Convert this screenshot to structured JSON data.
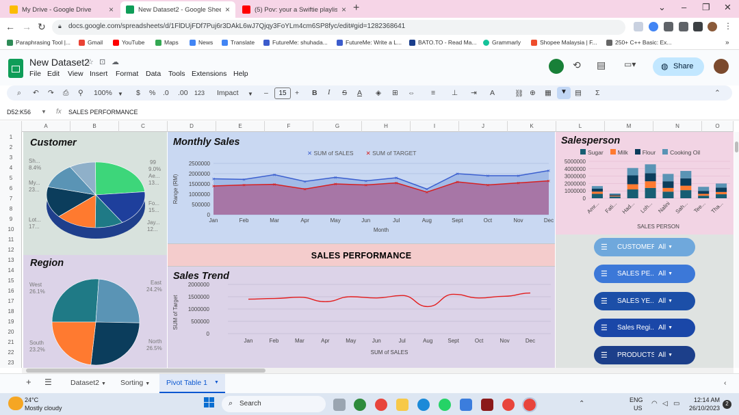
{
  "browser": {
    "tabs": [
      {
        "title": "My Drive - Google Drive",
        "color": "#fbbc04"
      },
      {
        "title": "New Dataset2 - Google Sheets",
        "color": "#0f9d58"
      },
      {
        "title": "(5) Pov: your a Swiftie playlis",
        "color": "#ff0000"
      }
    ],
    "url": "docs.google.com/spreadsheets/d/1FlDUjFDf7Puj6r3DAkL6wJ7Qjqy3FoYLm4cm6SP8fyc/edit#gid=1282368641",
    "bookmarks": [
      "Paraphrasing Tool |...",
      "Gmail",
      "YouTube",
      "Maps",
      "News",
      "Translate",
      "FutureMe: shuhada...",
      "FutureMe: Write a L...",
      "BATO.TO - Read Ma...",
      "Grammarly",
      "Shopee Malaysia | F...",
      "250+ C++ Basic: Ex..."
    ]
  },
  "sheets": {
    "doc_title": "New Dataset2",
    "menu": [
      "File",
      "Edit",
      "View",
      "Insert",
      "Format",
      "Data",
      "Tools",
      "Extensions",
      "Help"
    ],
    "share_label": "Share",
    "toolbar": {
      "zoom": "100%",
      "currency": "$",
      "percent": "%",
      "dec_less": ".0",
      "dec_more": ".00",
      "num_format": "123",
      "font": "Impact",
      "font_size": "15"
    },
    "name_box": "D52:K56",
    "formula": "SALES PERFORMANCE",
    "columns": [
      "A",
      "B",
      "C",
      "D",
      "E",
      "F",
      "G",
      "H",
      "I",
      "J",
      "K",
      "L",
      "M",
      "N",
      "O"
    ],
    "rows": [
      "1",
      "2",
      "3",
      "4",
      "5",
      "6",
      "7",
      "8",
      "9",
      "10",
      "11",
      "12",
      "13",
      "14",
      "15",
      "16",
      "17",
      "18",
      "19",
      "20",
      "21",
      "22",
      "23"
    ],
    "sheet_tabs": [
      "Dataset2",
      "Sorting",
      "Pivot Table 1"
    ],
    "active_tab": "Pivot Table 1"
  },
  "dashboard": {
    "banner": "SALES PERFORMANCE",
    "customer": {
      "title": "Customer",
      "labels": [
        {
          "name": "Sh...",
          "pct": "8.4%"
        },
        {
          "name": "My...",
          "pct": "23..."
        },
        {
          "name": "Lot...",
          "pct": "17..."
        },
        {
          "name": "99",
          "pct": "9.0%"
        },
        {
          "name": "Ae...",
          "pct": "13..."
        },
        {
          "name": "Fo...",
          "pct": "15..."
        },
        {
          "name": "Jay...",
          "pct": "12..."
        }
      ]
    },
    "region": {
      "title": "Region",
      "labels": [
        {
          "name": "West",
          "pct": "26.1%"
        },
        {
          "name": "East",
          "pct": "24.2%"
        },
        {
          "name": "South",
          "pct": "23.2%"
        },
        {
          "name": "North",
          "pct": "26.5%"
        }
      ]
    },
    "monthly_sales": {
      "title": "Monthly Sales",
      "legend": [
        "SUM of SALES",
        "SUM of TARGET"
      ],
      "ylabel": "Range (RM)",
      "xlabel": "Month",
      "yticks": [
        "2500000",
        "2000000",
        "1500000",
        "1000000",
        "500000",
        "0"
      ]
    },
    "sales_trend": {
      "title": "Sales Trend",
      "ylabel": "SUM of Target",
      "xlabel": "SUM of SALES",
      "yticks": [
        "2000000",
        "1500000",
        "1000000",
        "500000",
        "0"
      ]
    },
    "salesperson": {
      "title": "Salesperson",
      "legend": [
        "Sugar",
        "Milk",
        "Flour",
        "Cooking Oil"
      ],
      "xlabel": "SALES PERSON",
      "yticks": [
        "5000000",
        "4000000",
        "3000000",
        "2000000",
        "1000000",
        "0"
      ]
    },
    "slicers": [
      {
        "label": "CUSTOMER",
        "value": "All"
      },
      {
        "label": "SALES PE...",
        "value": "All"
      },
      {
        "label": "SALES YE...",
        "value": "All"
      },
      {
        "label": "Sales Regi...",
        "value": "All"
      },
      {
        "label": "PRODUCTS",
        "value": "All"
      }
    ]
  },
  "chart_data": [
    {
      "type": "pie",
      "categories": [
        "Sh...",
        "My...",
        "Lot...",
        "99",
        "Ae...",
        "Fo...",
        "Jay..."
      ],
      "values": [
        8.4,
        23,
        17,
        9.0,
        13,
        15,
        12
      ],
      "title": "Customer"
    },
    {
      "type": "pie",
      "categories": [
        "West",
        "East",
        "North",
        "South"
      ],
      "values": [
        26.1,
        24.2,
        26.5,
        23.2
      ],
      "title": "Region"
    },
    {
      "type": "area",
      "title": "Monthly Sales",
      "categories": [
        "Jan",
        "Feb",
        "Mar",
        "Apr",
        "May",
        "Jun",
        "Jul",
        "Aug",
        "Sept",
        "Oct",
        "Nov",
        "Dec"
      ],
      "series": [
        {
          "name": "SUM of SALES",
          "values": [
            1750000,
            1720000,
            1950000,
            1620000,
            1820000,
            1650000,
            1800000,
            1250000,
            2000000,
            1900000,
            1900000,
            2150000
          ]
        },
        {
          "name": "SUM of TARGET",
          "values": [
            1400000,
            1450000,
            1480000,
            1250000,
            1500000,
            1450000,
            1550000,
            1100000,
            1600000,
            1450000,
            1550000,
            1650000
          ]
        }
      ],
      "xlabel": "Month",
      "ylabel": "Range (RM)",
      "ylim": [
        0,
        2500000
      ]
    },
    {
      "type": "line",
      "title": "Sales Trend",
      "categories": [
        "Jan",
        "Feb",
        "Mar",
        "Apr",
        "May",
        "Jun",
        "Jul",
        "Aug",
        "Sept",
        "Oct",
        "Nov",
        "Dec"
      ],
      "series": [
        {
          "values": [
            1400000,
            1430000,
            1480000,
            1300000,
            1500000,
            1450000,
            1550000,
            1100000,
            1600000,
            1450000,
            1520000,
            1650000
          ]
        }
      ],
      "xlabel": "SUM of SALES",
      "ylabel": "SUM of Target",
      "ylim": [
        0,
        2000000
      ]
    },
    {
      "type": "bar",
      "title": "Salesperson",
      "categories": [
        "Amr...",
        "Fati...",
        "Had...",
        "Loh...",
        "Nalini",
        "Sah...",
        "Tee...",
        "Tha..."
      ],
      "series": [
        {
          "name": "Sugar",
          "values": [
            600000,
            250000,
            1200000,
            1400000,
            900000,
            1100000,
            350000,
            550000
          ]
        },
        {
          "name": "Milk",
          "values": [
            300000,
            100000,
            700000,
            900000,
            500000,
            600000,
            250000,
            300000
          ]
        },
        {
          "name": "Flour",
          "values": [
            400000,
            150000,
            1200000,
            1100000,
            900000,
            1000000,
            400000,
            600000
          ]
        },
        {
          "name": "Cooking Oil",
          "values": [
            350000,
            150000,
            1000000,
            1200000,
            1000000,
            1000000,
            550000,
            550000
          ]
        }
      ],
      "xlabel": "SALES PERSON",
      "ylim": [
        0,
        5000000
      ]
    }
  ],
  "taskbar": {
    "weather_temp": "24°C",
    "weather_desc": "Mostly cloudy",
    "search": "Search",
    "lang": "ENG",
    "region": "US",
    "time": "12:14 AM",
    "date": "26/10/2023",
    "notif": "2"
  }
}
